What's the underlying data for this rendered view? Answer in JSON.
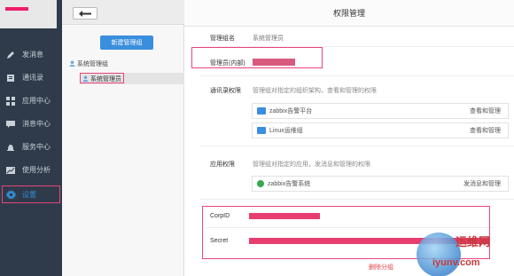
{
  "nav": {
    "items": [
      {
        "label": "发消息",
        "icon": "pencil-icon"
      },
      {
        "label": "通讯录",
        "icon": "contacts-icon"
      },
      {
        "label": "应用中心",
        "icon": "apps-icon"
      },
      {
        "label": "消息中心",
        "icon": "message-icon"
      },
      {
        "label": "服务中心",
        "icon": "service-icon"
      },
      {
        "label": "使用分析",
        "icon": "analytics-icon"
      },
      {
        "label": "设置",
        "icon": "gear-icon"
      }
    ],
    "active_index": 6
  },
  "mid": {
    "new_group_label": "新建管理组",
    "tree_root_label": "系统管理组",
    "tree_child_label": "系统管理员"
  },
  "main": {
    "title": "权限管理",
    "group_name_label": "管理组名",
    "group_name_value": "系统管理员",
    "admin_label": "管理员(内部)",
    "contacts_perm_label": "通讯录权限",
    "contacts_perm_desc": "管理组对指定的组织架构，查看和管理的权限",
    "contacts": [
      {
        "name": "zabbix告警平台",
        "action": "查看和管理"
      },
      {
        "name": "Linux运维组",
        "action": "查看和管理"
      }
    ],
    "app_perm_label": "应用权限",
    "app_perm_desc": "管理组对指定的应用，发消息和管理的权限",
    "apps": [
      {
        "name": "zabbix告警系统",
        "action": "发消息和管理"
      }
    ],
    "corpid_label": "CorpID",
    "secret_label": "Secret",
    "delete_label": "删除分组"
  },
  "watermark": {
    "cn": "运维网",
    "url": "iyunv.com"
  },
  "colors": {
    "nav_bg": "#2f3b4a",
    "accent": "#3a8ede",
    "highlight": "#e8457b"
  }
}
